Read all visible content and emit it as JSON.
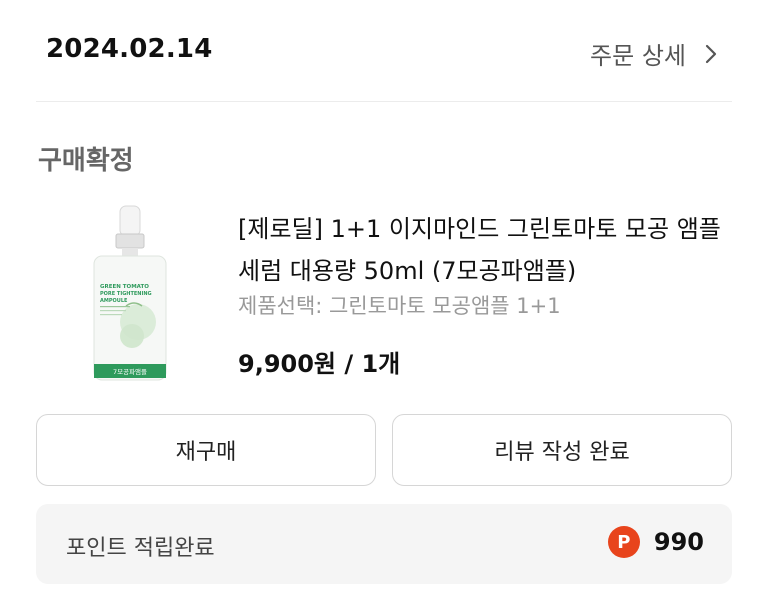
{
  "header": {
    "date": "2024.02.14",
    "detail_label": "주문 상세"
  },
  "order": {
    "status": "구매확정"
  },
  "product": {
    "title": "[제로딜] 1+1 이지마인드 그린토마토 모공 앰플 세럼 대용량 50ml (7모공파앰플)",
    "option": "제품선택: 그린토마토 모공앰플 1+1",
    "price": "9,900원 / 1개",
    "image_label_line1": "GREEN TOMATO",
    "image_label_line2": "PORE TIGHTENING",
    "image_label_line3": "AMPOULE",
    "image_badge": "7모공파앰플"
  },
  "actions": {
    "rebuy_label": "재구매",
    "review_label": "리뷰 작성 완료"
  },
  "points": {
    "label": "포인트 적립완료",
    "badge": "P",
    "amount": "990"
  },
  "colors": {
    "points_badge": "#e8441c",
    "bottle_accent": "#2e9a5c"
  }
}
